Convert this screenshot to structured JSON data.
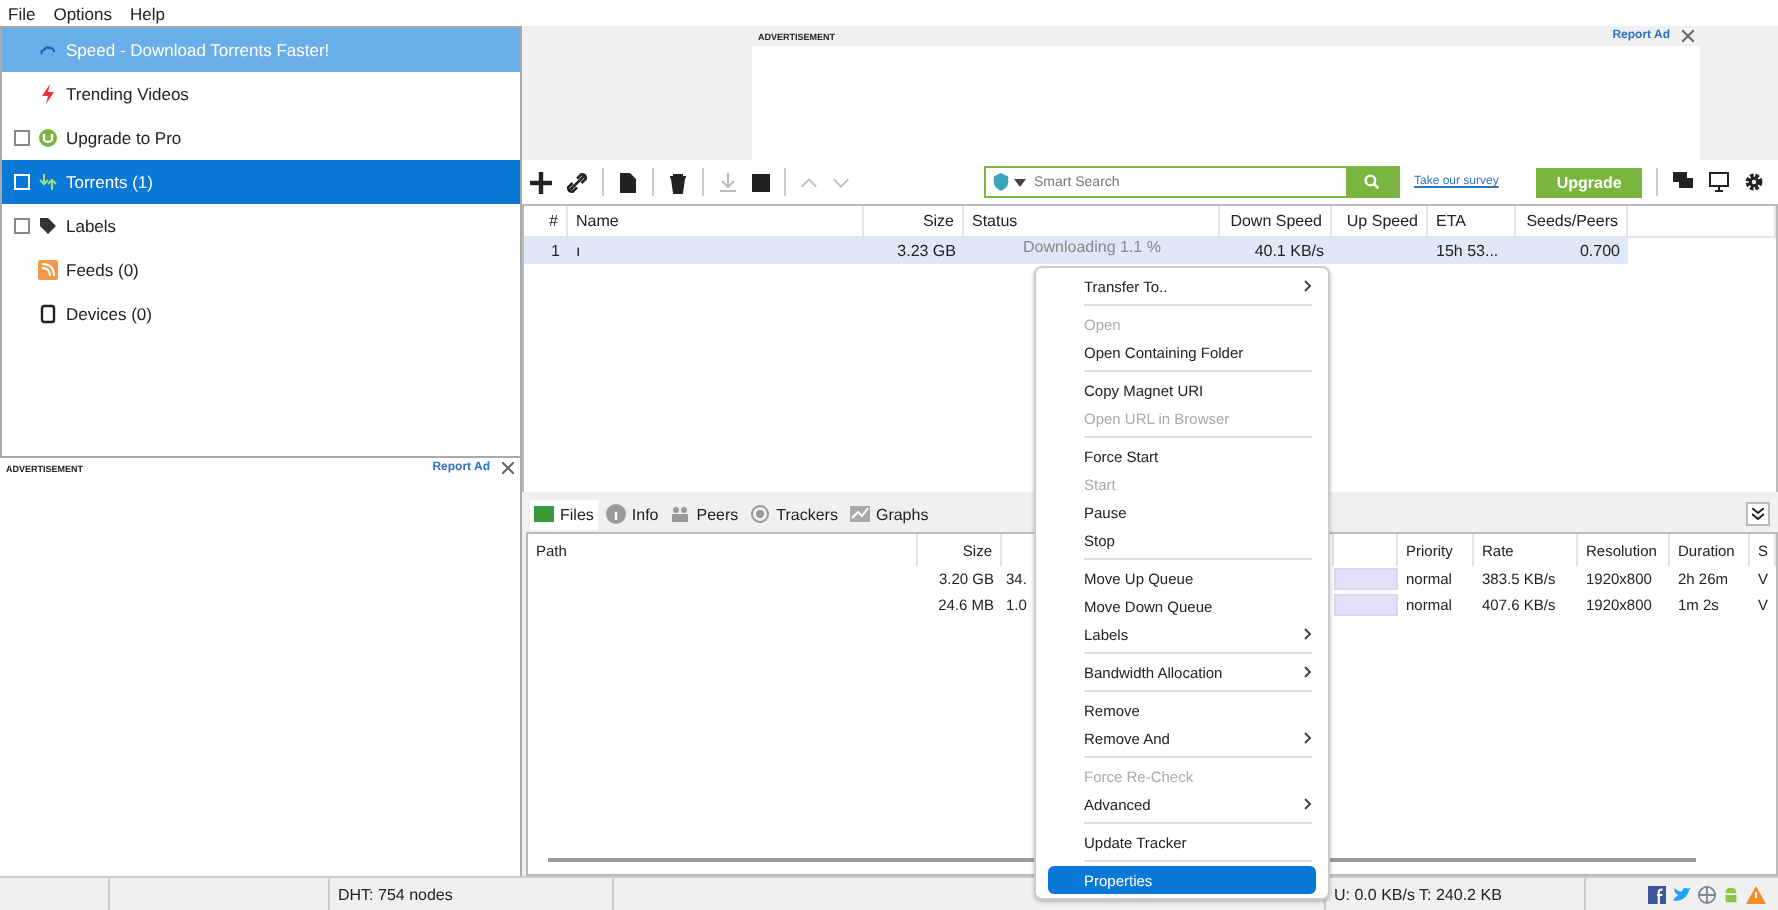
{
  "menu_bar": [
    "File",
    "Options",
    "Help"
  ],
  "sidebar": {
    "items": [
      {
        "label": "Speed - Download Torrents Faster!",
        "selected": false,
        "highlighted": true,
        "expandable": false
      },
      {
        "label": "Trending Videos",
        "selected": false,
        "highlighted": false,
        "expandable": false
      },
      {
        "label": "Upgrade to Pro",
        "selected": false,
        "highlighted": false,
        "expandable": true
      },
      {
        "label": "Torrents (1)",
        "selected": true,
        "highlighted": false,
        "expandable": true
      },
      {
        "label": "Labels",
        "selected": false,
        "highlighted": false,
        "expandable": true
      },
      {
        "label": "Feeds (0)",
        "selected": false,
        "highlighted": false,
        "expandable": false
      },
      {
        "label": "Devices (0)",
        "selected": false,
        "highlighted": false,
        "expandable": false
      }
    ]
  },
  "side_ad": {
    "label": "ADVERTISEMENT",
    "report": "Report Ad"
  },
  "top_ad": {
    "label": "ADVERTISEMENT",
    "report": "Report Ad"
  },
  "toolbar": {
    "search": {
      "placeholder": "Smart Search"
    },
    "survey_link": "Take our survey",
    "upgrade_button": "Upgrade"
  },
  "torrent_table": {
    "columns": [
      "#",
      "Name",
      "Size",
      "Status",
      "Down Speed",
      "Up Speed",
      "ETA",
      "Seeds/Peers"
    ],
    "rows": [
      {
        "cells": [
          "1",
          "ı",
          "3.23 GB",
          "Downloading 1.1 %",
          "40.1 KB/s",
          "",
          "15h 53...",
          "0.700"
        ],
        "selected": true
      }
    ]
  },
  "detail_tabs": [
    {
      "label": "Files",
      "selected": true
    },
    {
      "label": "Info",
      "selected": false
    },
    {
      "label": "Peers",
      "selected": false
    },
    {
      "label": "Trackers",
      "selected": false
    },
    {
      "label": "Graphs",
      "selected": false
    }
  ],
  "files_table": {
    "columns": [
      "Path",
      "Size",
      "",
      "",
      "Priority",
      "Rate",
      "Resolution",
      "Duration",
      "S"
    ],
    "rows": [
      {
        "cells": [
          "",
          "3.20 GB",
          "34.",
          "",
          "normal",
          "383.5 KB/s",
          "1920x800",
          "2h 26m",
          "V"
        ],
        "level": 1
      },
      {
        "cells": [
          "",
          "24.6 MB",
          "1.0",
          "",
          "normal",
          "407.6 KB/s",
          "1920x800",
          "1m 2s",
          "V"
        ],
        "level": 1
      }
    ]
  },
  "context_menu": [
    {
      "kind": "item",
      "label": "Transfer To..",
      "submenu": true,
      "disabled": false,
      "selected": false
    },
    {
      "kind": "separator"
    },
    {
      "kind": "item",
      "label": "Open",
      "submenu": false,
      "disabled": true,
      "selected": false
    },
    {
      "kind": "item",
      "label": "Open Containing Folder",
      "submenu": false,
      "disabled": false,
      "selected": false
    },
    {
      "kind": "separator"
    },
    {
      "kind": "item",
      "label": "Copy Magnet URI",
      "submenu": false,
      "disabled": false,
      "selected": false
    },
    {
      "kind": "item",
      "label": "Open URL in Browser",
      "submenu": false,
      "disabled": true,
      "selected": false
    },
    {
      "kind": "separator"
    },
    {
      "kind": "item",
      "label": "Force Start",
      "submenu": false,
      "disabled": false,
      "selected": false
    },
    {
      "kind": "item",
      "label": "Start",
      "submenu": false,
      "disabled": true,
      "selected": false
    },
    {
      "kind": "item",
      "label": "Pause",
      "submenu": false,
      "disabled": false,
      "selected": false
    },
    {
      "kind": "item",
      "label": "Stop",
      "submenu": false,
      "disabled": false,
      "selected": false
    },
    {
      "kind": "separator"
    },
    {
      "kind": "item",
      "label": "Move Up Queue",
      "submenu": false,
      "disabled": false,
      "selected": false
    },
    {
      "kind": "item",
      "label": "Move Down Queue",
      "submenu": false,
      "disabled": false,
      "selected": false
    },
    {
      "kind": "item",
      "label": "Labels",
      "submenu": true,
      "disabled": false,
      "selected": false
    },
    {
      "kind": "separator"
    },
    {
      "kind": "item",
      "label": "Bandwidth Allocation",
      "submenu": true,
      "disabled": false,
      "selected": false
    },
    {
      "kind": "separator"
    },
    {
      "kind": "item",
      "label": "Remove",
      "submenu": false,
      "disabled": false,
      "selected": false
    },
    {
      "kind": "item",
      "label": "Remove And",
      "submenu": true,
      "disabled": false,
      "selected": false
    },
    {
      "kind": "separator"
    },
    {
      "kind": "item",
      "label": "Force Re-Check",
      "submenu": false,
      "disabled": true,
      "selected": false
    },
    {
      "kind": "item",
      "label": "Advanced",
      "submenu": true,
      "disabled": false,
      "selected": false
    },
    {
      "kind": "separator"
    },
    {
      "kind": "item",
      "label": "Update Tracker",
      "submenu": false,
      "disabled": false,
      "selected": false
    },
    {
      "kind": "separator"
    },
    {
      "kind": "item",
      "label": "Properties",
      "submenu": false,
      "disabled": false,
      "selected": true
    }
  ],
  "status_bar": {
    "dht": "DHT: 754 nodes",
    "transfer": "U: 0.0 KB/s T: 240.2 KB"
  }
}
